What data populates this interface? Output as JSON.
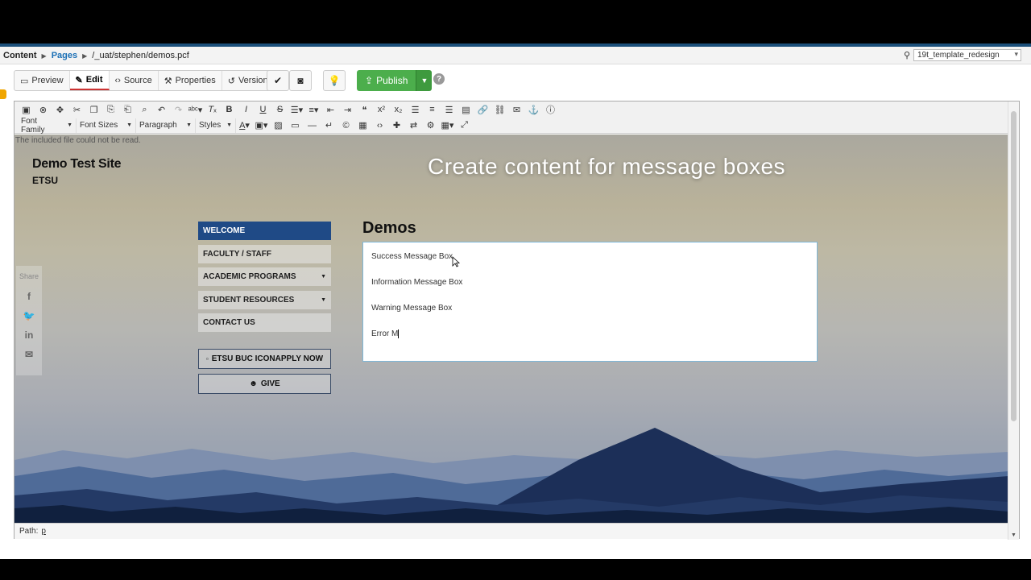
{
  "breadcrumb": {
    "content": "Content",
    "pages": "Pages",
    "path": "/_uat/stephen/demos.pcf"
  },
  "site_select": {
    "value": "19t_template_redesign"
  },
  "view_tabs": [
    {
      "label": "Preview",
      "icon": "monitor-icon"
    },
    {
      "label": "Edit",
      "icon": "pencil-icon"
    },
    {
      "label": "Source",
      "icon": "code-icon"
    },
    {
      "label": "Properties",
      "icon": "wrench-icon"
    },
    {
      "label": "Versions",
      "icon": "history-icon"
    }
  ],
  "publish": {
    "label": "Publish"
  },
  "toolbar2": {
    "font_family": "Font Family",
    "font_sizes": "Font Sizes",
    "format": "Paragraph",
    "styles": "Styles"
  },
  "editor": {
    "error_note": "The included file could not be read.",
    "path_label": "Path:",
    "path_value": "p"
  },
  "site": {
    "name": "Demo Test Site",
    "org": "ETSU",
    "overlay_title": "Create content for message boxes",
    "nav": [
      {
        "label": "WELCOME",
        "active": true,
        "has_submenu": false
      },
      {
        "label": "FACULTY / STAFF",
        "active": false,
        "has_submenu": false
      },
      {
        "label": "ACADEMIC PROGRAMS",
        "active": false,
        "has_submenu": true
      },
      {
        "label": "STUDENT RESOURCES",
        "active": false,
        "has_submenu": true
      },
      {
        "label": "CONTACT US",
        "active": false,
        "has_submenu": false
      }
    ],
    "apply_button": "ETSU BUC ICONAPPLY NOW",
    "give_button": "GIVE",
    "share_label": "Share",
    "page_heading": "Demos",
    "message_lines": [
      "Success Message Box",
      "Information Message Box",
      "Warning Message Box",
      "Error M"
    ]
  },
  "colors": {
    "accent_green": "#4cae4c",
    "nav_active": "#1f4a86",
    "link_blue": "#1a6fb5"
  }
}
